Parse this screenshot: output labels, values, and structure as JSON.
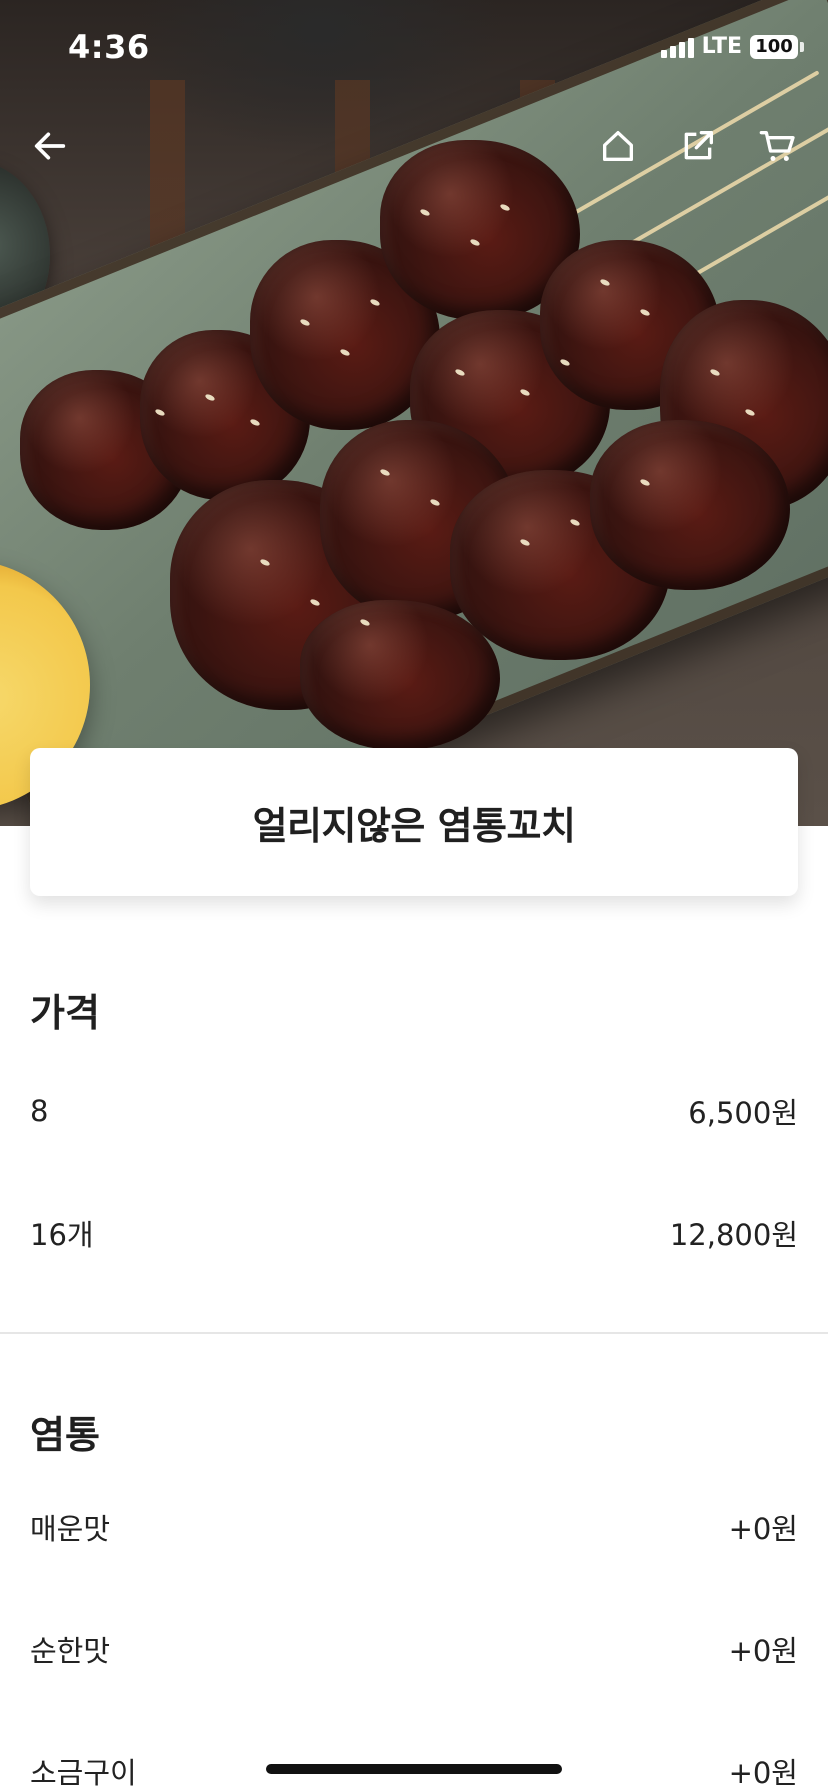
{
  "status_bar": {
    "time": "4:36",
    "network": "LTE",
    "battery": "100"
  },
  "hero_image": {
    "description_icon": "food-photo"
  },
  "nav": {
    "back_icon": "arrow-left-icon",
    "home_icon": "home-icon",
    "share_icon": "share-icon",
    "cart_icon": "cart-icon"
  },
  "product": {
    "title": "얼리지않은 염통꼬치"
  },
  "price_section": {
    "title": "가격",
    "options": [
      {
        "label": "8",
        "price": "6,500원"
      },
      {
        "label": "16개",
        "price": "12,800원"
      }
    ]
  },
  "flavor_section": {
    "title": "염통",
    "options": [
      {
        "label": "매운맛",
        "price": "+0원"
      },
      {
        "label": "순한맛",
        "price": "+0원"
      },
      {
        "label": "소금구이",
        "price": "+0원"
      }
    ]
  },
  "colors": {
    "text_primary": "#202020",
    "divider": "#e6e6e6",
    "background": "#ffffff"
  }
}
